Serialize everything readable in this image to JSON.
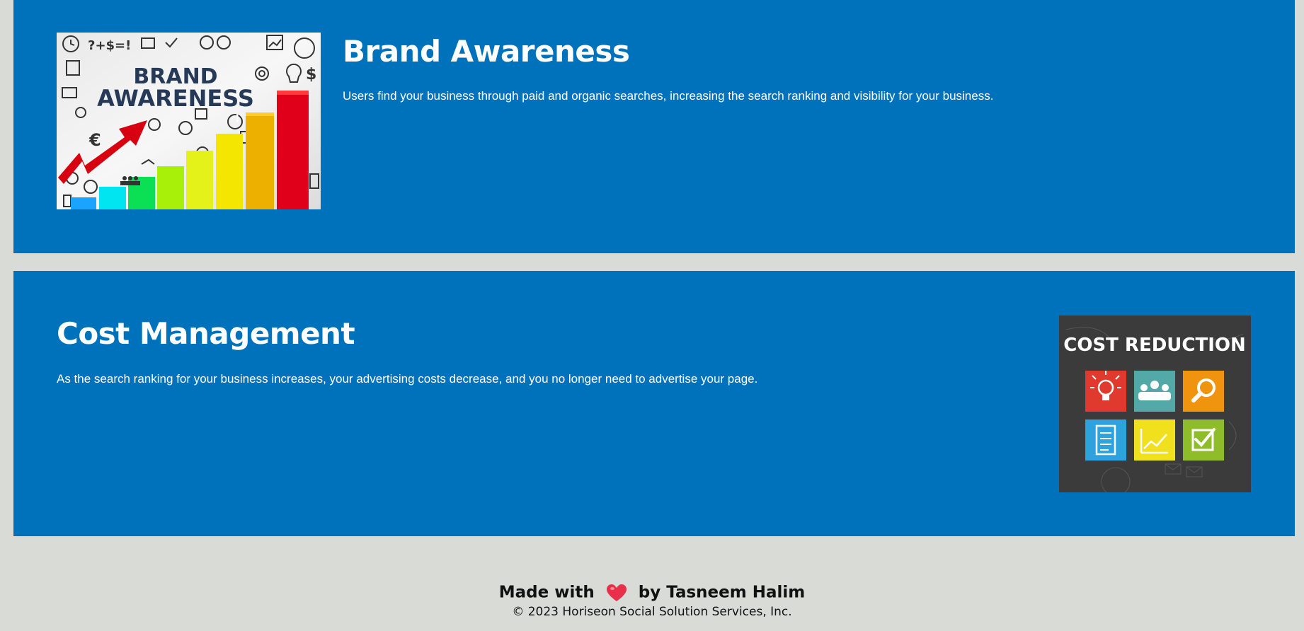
{
  "sections": {
    "brand": {
      "heading": "Brand Awareness",
      "text": "Users find your business through paid and organic searches, increasing the search ranking and visibility for your business.",
      "image": {
        "line1": "BRAND",
        "line2": "AWARENESS",
        "icons": [
          "clock-icon",
          "chart-icon",
          "bulb-icon",
          "dollar-icon",
          "euro-icon",
          "target-icon",
          "people-icon"
        ]
      }
    },
    "cost": {
      "heading": "Cost Management",
      "text": "As the search ranking for your business increases, your advertising costs decrease, and you no longer need to advertise your page.",
      "image": {
        "title": "COST REDUCTION",
        "tiles": [
          {
            "icon": "lightbulb-icon",
            "color": "#e03a2f"
          },
          {
            "icon": "team-icon",
            "color": "#53a8a8"
          },
          {
            "icon": "magnifier-icon",
            "color": "#f0930f"
          },
          {
            "icon": "clipboard-icon",
            "color": "#2ea2dc"
          },
          {
            "icon": "growth-chart-icon",
            "color": "#f0e01e"
          },
          {
            "icon": "checkmark-icon",
            "color": "#8fbd2a"
          }
        ]
      }
    }
  },
  "footer": {
    "made_prefix": "Made with",
    "made_suffix": "by Tasneem Halim",
    "heart_icon": "heart-icon",
    "copyright": "© 2023 Horiseon Social Solution Services, Inc."
  },
  "colors": {
    "page_background": "#d9dcd6",
    "section_background": "#0072bb",
    "heart": "#e8304a"
  }
}
